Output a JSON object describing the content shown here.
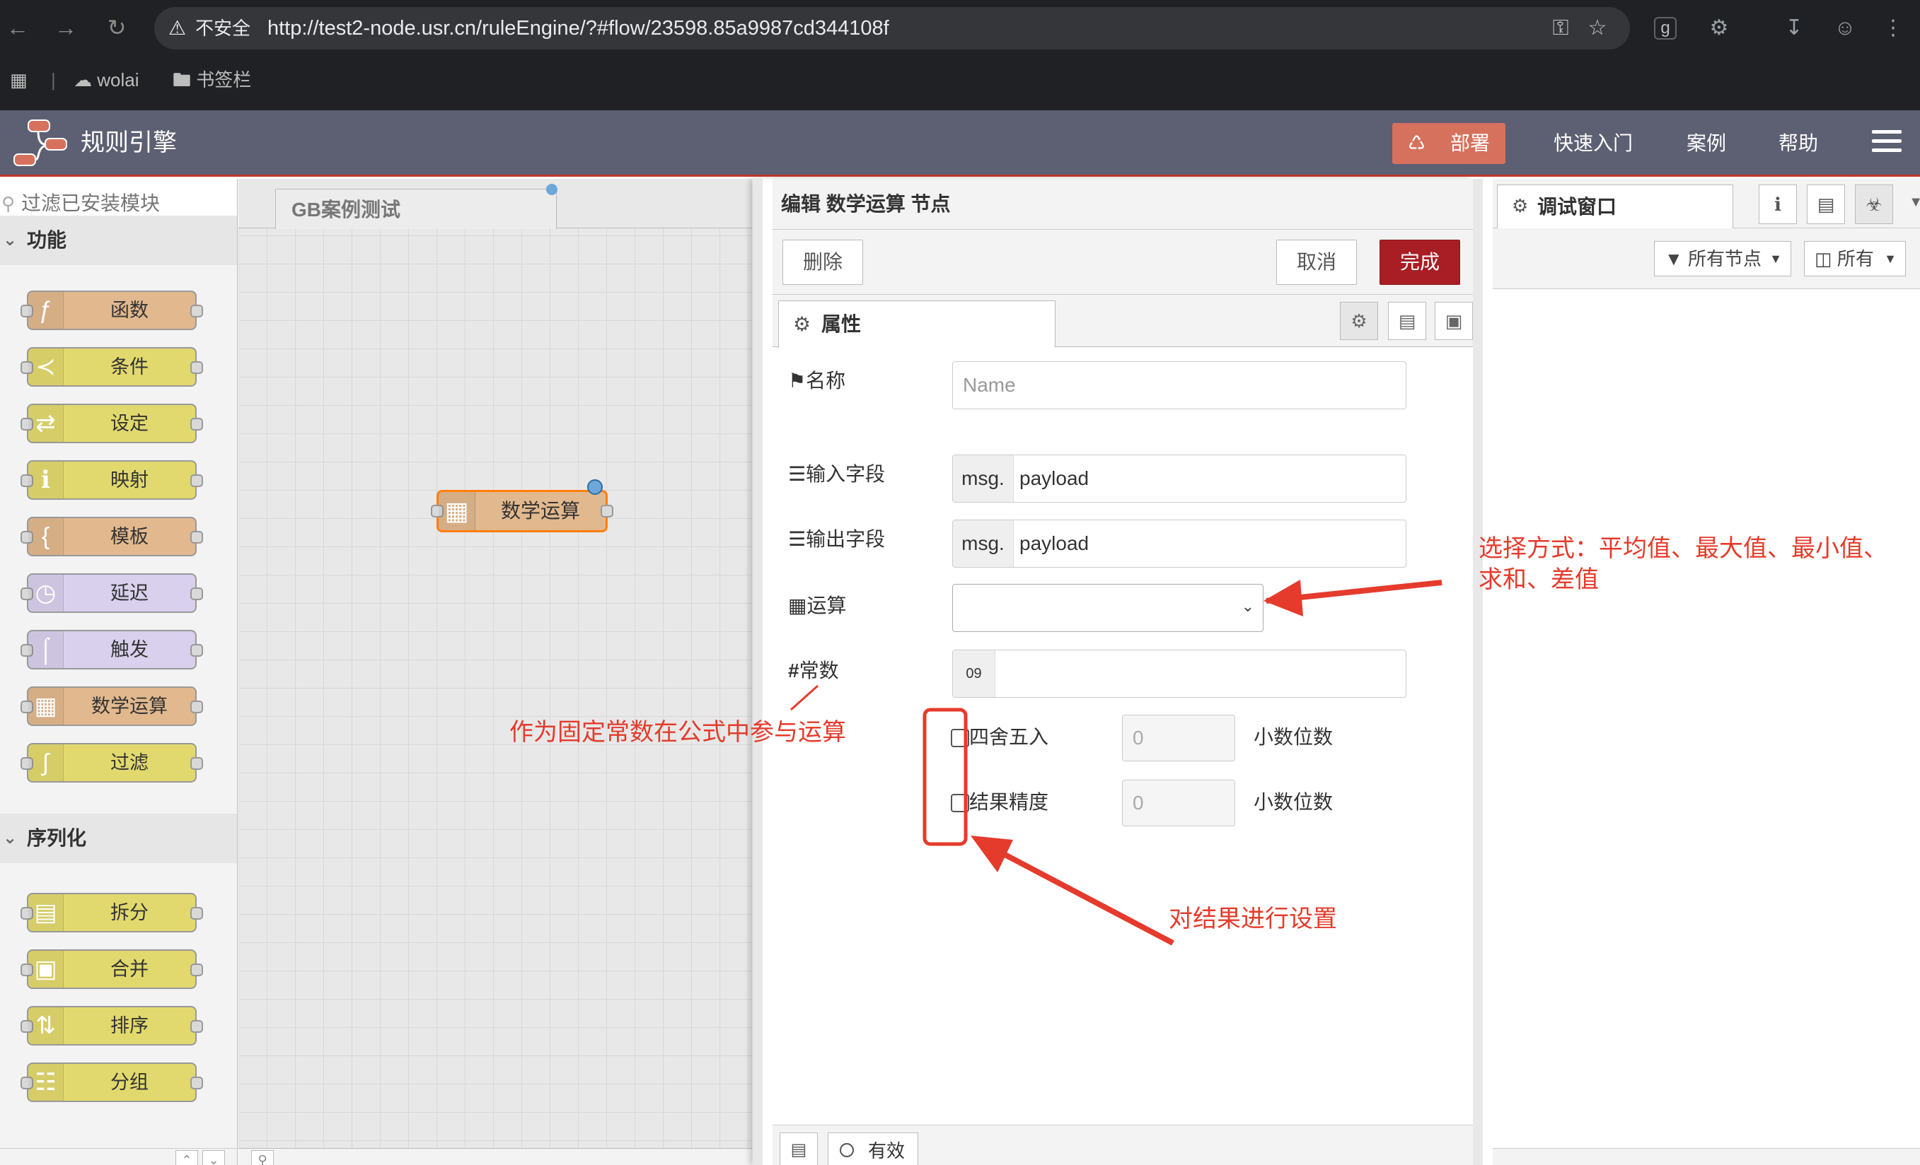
{
  "browser": {
    "insecure_label": "不安全",
    "url": "http://test2-node.usr.cn/ruleEngine/?#flow/23598.85a9987cd344108f",
    "extension_letter": "g",
    "bookmarks": [
      {
        "label": "wolai",
        "icon": "cloud-icon"
      },
      {
        "label": "书签栏",
        "icon": "folder-icon"
      }
    ]
  },
  "header": {
    "title": "规则引擎",
    "deploy_label": "部署",
    "links": [
      "快速入门",
      "案例",
      "帮助"
    ],
    "colors": {
      "bar": "#5d5f73",
      "deploy": "#d6715d",
      "accent": "#c0392b"
    }
  },
  "palette": {
    "search_placeholder": "过滤已安装模块",
    "categories": [
      {
        "label": "功能",
        "nodes": [
          {
            "label": "函数",
            "icon": "function-icon",
            "color": "#e2b88e"
          },
          {
            "label": "条件",
            "icon": "switch-icon",
            "color": "#e2d96e"
          },
          {
            "label": "设定",
            "icon": "shuffle-icon",
            "color": "#e2d96e"
          },
          {
            "label": "映射",
            "icon": "map-icon",
            "color": "#e2d96e"
          },
          {
            "label": "模板",
            "icon": "template-icon",
            "color": "#e2b88e"
          },
          {
            "label": "延迟",
            "icon": "timer-icon",
            "color": "#d8d0ec"
          },
          {
            "label": "触发",
            "icon": "trigger-icon",
            "color": "#d8d0ec"
          },
          {
            "label": "数学运算",
            "icon": "calculator-icon",
            "color": "#e2b88e"
          },
          {
            "label": "过滤",
            "icon": "filter-icon",
            "color": "#e2d96e"
          }
        ]
      },
      {
        "label": "序列化",
        "nodes": [
          {
            "label": "拆分",
            "icon": "split-icon",
            "color": "#e2d96e"
          },
          {
            "label": "合并",
            "icon": "join-icon",
            "color": "#e2d96e"
          },
          {
            "label": "排序",
            "icon": "sort-icon",
            "color": "#e2d96e"
          },
          {
            "label": "分组",
            "icon": "batch-icon",
            "color": "#e2d96e"
          }
        ]
      }
    ]
  },
  "workspace": {
    "tab_label": "GB案例测试",
    "node_label": "数学运算"
  },
  "tray": {
    "title": "编辑 数学运算 节点",
    "delete_label": "删除",
    "cancel_label": "取消",
    "done_label": "完成",
    "properties_tab": "属性",
    "fields": {
      "name_label": "名称",
      "name_placeholder": "Name",
      "input_label": "输入字段",
      "input_prefix": "msg.",
      "input_value": "payload",
      "output_label": "输出字段",
      "output_prefix": "msg.",
      "output_value": "payload",
      "operation_label": "运算",
      "operation_value": "",
      "constant_label": "常数",
      "constant_type": "09",
      "constant_value": "",
      "round_label": "四舍五入",
      "round_placeholder": "0",
      "round_suffix": "小数位数",
      "precision_label": "结果精度",
      "precision_placeholder": "0",
      "precision_suffix": "小数位数"
    },
    "footer_enabled": "有效"
  },
  "sidebar": {
    "tab_label": "调试窗口",
    "filter_nodes": "所有节点",
    "filter_all": "所有"
  },
  "annotations": {
    "operation_note_line1": "选择方式：平均值、最大值、最小值、",
    "operation_note_line2": "求和、差值",
    "constant_note": "作为固定常数在公式中参与运算",
    "result_note": "对结果进行设置",
    "color": "#e53b2c"
  }
}
